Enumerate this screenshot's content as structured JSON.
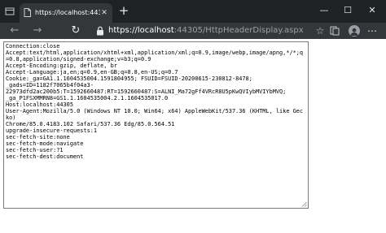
{
  "tab": {
    "title": "https://localhost:44305/HttpHe",
    "close_glyph": "✕"
  },
  "new_tab_glyph": "+",
  "window_controls": {
    "minimize": "—",
    "maximize": "☐",
    "close": "✕"
  },
  "nav": {
    "back": "←",
    "forward": "→",
    "reload": "↻"
  },
  "address": {
    "protocol": "https://",
    "host": "localhost",
    "rest": ":44305/HttpHeaderDisplay.aspx"
  },
  "toolbar": {
    "star": "☆",
    "more": "⋯"
  },
  "colors": {
    "titlebar": "#202124",
    "toolbar": "#35363a",
    "url_dim": "#9aa0a6",
    "textarea_border": "#7a7a7a"
  },
  "headers_text": "Connection:close\nAccept:text/html,application/xhtml+xml,application/xml;q=0.9,image/webp,image/apng,*/*;q=0.8,application/signed-exchange;v=b3;q=0.9\nAccept-Encoding:gzip, deflate, br\nAccept-Language:ja,en;q=0.9,en-GB;q=0.8,en-US;q=0.7\nCookie:_ga=GA1.1.1604535004.1591804955; FSUID=FSUID-20200615-230812-8478;\n_gads=ID=1182f7065b4f04a3-\n22973dfd2ac200b5:T=1592660487:RT=1592660487:S=ALNI_Ma72gFf4VRcR8U5pKwQVIybMVIYbMVQ;\n_ga_P1FSXMMRN8=GS1.1.1604535004.2.1.1604535017.0\nHost:localhost:44305\nUser-Agent:Mozilla/5.0 (Windows NT 10.0; Win64; x64) AppleWebKit/537.36 (KHTML, like Gecko)\nChrome/85.0.4183.102 Safari/537.36 Edg/85.0.564.51\nupgrade-insecure-requests:1\nsec-fetch-site:none\nsec-fetch-mode:navigate\nsec-fetch-user:?1\nsec-fetch-dest:document"
}
